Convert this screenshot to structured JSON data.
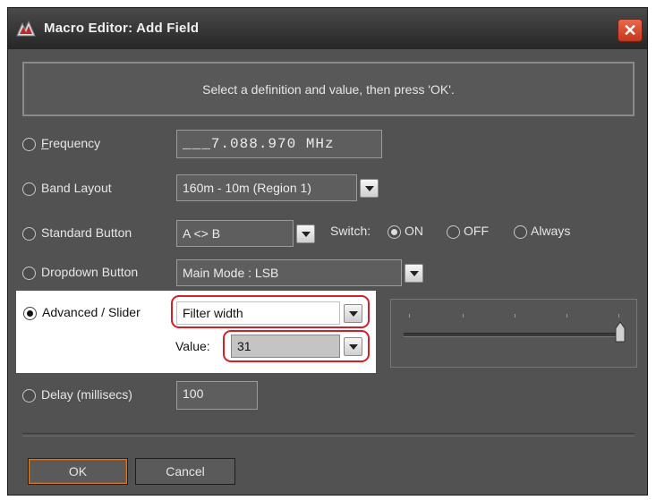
{
  "window": {
    "title": "Macro Editor: Add Field",
    "close_glyph": "✕"
  },
  "instruction": "Select a definition and value, then press 'OK'.",
  "fields": {
    "frequency": {
      "label_first": "F",
      "label_rest": "requency",
      "value": "___7.088.970 MHz",
      "selected": false
    },
    "band_layout": {
      "label": "Band Layout",
      "value": "160m - 10m (Region 1)",
      "selected": false
    },
    "standard_button": {
      "label": "Standard Button",
      "value": "A <> B",
      "selected": false
    },
    "switch": {
      "label": "Switch:",
      "options": [
        "ON",
        "OFF",
        "Always"
      ],
      "selected": "ON"
    },
    "dropdown_button": {
      "label": "Dropdown Button",
      "value": "Main Mode : LSB",
      "selected": false
    },
    "advanced_slider": {
      "label": "Advanced / Slider",
      "value": "Filter width",
      "value_label": "Value:",
      "number": "31",
      "selected": true,
      "slider_level": 1.0
    },
    "delay": {
      "label": "Delay (millisecs)",
      "value": "100",
      "selected": false
    }
  },
  "buttons": {
    "ok": "OK",
    "cancel": "Cancel"
  },
  "icons": {
    "app": "macro-editor-app-icon",
    "close": "close-icon",
    "dropdown": "chevron-down-icon"
  },
  "colors": {
    "highlight_ring": "#d0202a",
    "close_button": "#d8482e",
    "ok_border": "#d07a2a"
  }
}
